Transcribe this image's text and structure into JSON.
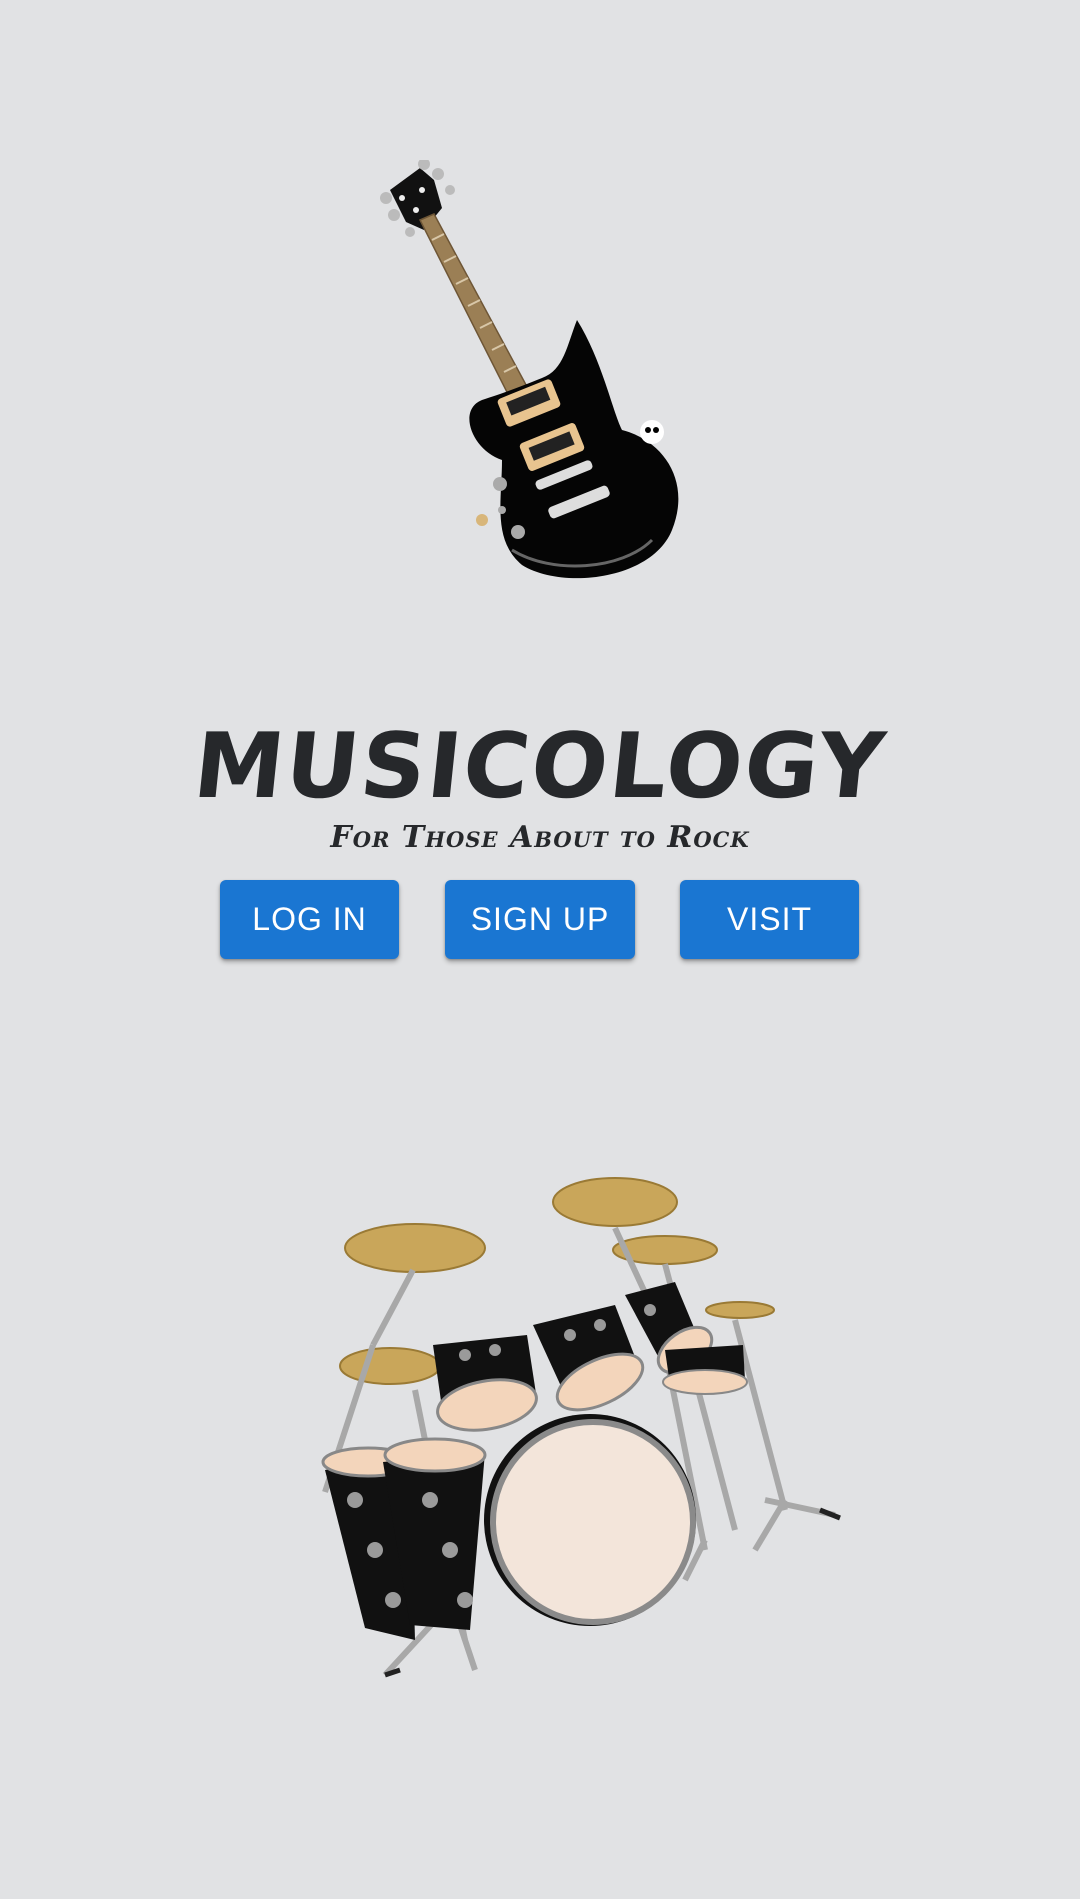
{
  "app": {
    "title": "MUSICOLOGY",
    "tagline": "For Those About to Rock"
  },
  "buttons": {
    "login_label": "LOG IN",
    "signup_label": "SIGN UP",
    "visit_label": "VISIT"
  },
  "images": {
    "top_illustration": "electric-guitar",
    "bottom_illustration": "drum-kit"
  },
  "colors": {
    "background": "#e1e2e4",
    "button": "#1a76d2",
    "button_text": "#ffffff",
    "title_text": "#26282b"
  }
}
